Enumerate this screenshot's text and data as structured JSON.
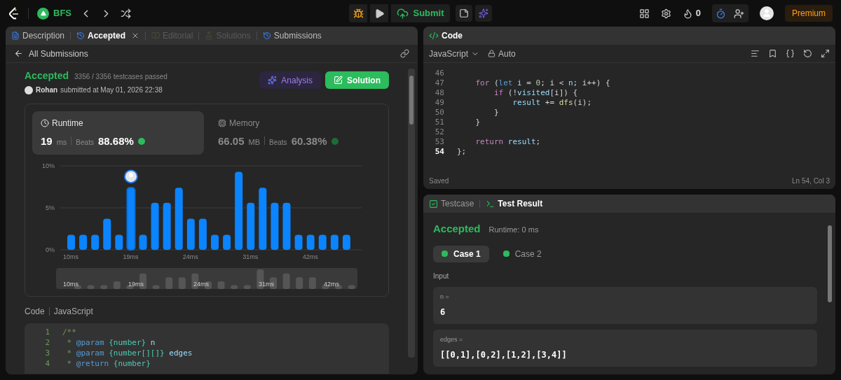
{
  "topbar": {
    "problem_title": "BFS",
    "submit_label": "Submit",
    "streak_count": "0",
    "premium_label": "Premium"
  },
  "left_panel": {
    "tabs": [
      {
        "label": "Description",
        "selected": false,
        "disabled": false,
        "kind": "description"
      },
      {
        "label": "Accepted",
        "selected": true,
        "disabled": false,
        "kind": "history"
      },
      {
        "label": "Editorial",
        "selected": false,
        "disabled": true,
        "kind": "editorial"
      },
      {
        "label": "Solutions",
        "selected": false,
        "disabled": true,
        "kind": "solutions"
      },
      {
        "label": "Submissions",
        "selected": false,
        "disabled": false,
        "kind": "history"
      }
    ],
    "back_label": "All Submissions",
    "status": "Accepted",
    "testcases": "3356 / 3356 testcases passed",
    "user": "Rohan",
    "submitted": "submitted at May 01, 2026 22:38",
    "analysis_label": "Analysis",
    "solution_label": "Solution",
    "stats": [
      {
        "title": "Runtime",
        "number": "19",
        "unit": "ms",
        "beats_label": "Beats",
        "beats": "88.68%",
        "selected": true,
        "kind": "runtime"
      },
      {
        "title": "Memory",
        "number": "66.05",
        "unit": "MB",
        "beats_label": "Beats",
        "beats": "60.38%",
        "selected": false,
        "kind": "memory"
      }
    ],
    "chart": {
      "chart_data": {
        "type": "bar",
        "categories": [
          "10ms",
          null,
          null,
          null,
          null,
          "19ms",
          null,
          null,
          null,
          null,
          "24ms",
          null,
          null,
          null,
          null,
          "31ms",
          null,
          null,
          null,
          null,
          "42ms",
          null,
          null,
          null
        ],
        "series": [
          {
            "color": "#0a84ff",
            "values": [
              1.8,
              1.8,
              1.8,
              3.7,
              1.8,
              7.4,
              1.8,
              5.6,
              5.6,
              7.4,
              3.7,
              3.7,
              1.8,
              1.8,
              9.3,
              5.6,
              7.4,
              5.6,
              5.6,
              1.8,
              1.8,
              1.8,
              1.8,
              1.8
            ]
          }
        ],
        "ylim": [
          0,
          10
        ],
        "yticks": [
          {
            "value": 0,
            "label": "0%"
          },
          {
            "value": 5,
            "label": "5%"
          },
          {
            "value": 10,
            "label": "10%"
          }
        ]
      },
      "bars": [
        {
          "selected": false
        },
        {
          "selected": false
        },
        {
          "selected": false
        },
        {
          "selected": false
        },
        {
          "selected": false
        },
        {
          "selected": true
        },
        {
          "selected": false
        },
        {
          "selected": false
        },
        {
          "selected": false
        },
        {
          "selected": false
        },
        {
          "selected": false
        },
        {
          "selected": false
        },
        {
          "selected": false
        },
        {
          "selected": false
        },
        {
          "selected": false
        },
        {
          "selected": false
        },
        {
          "selected": false
        },
        {
          "selected": false
        },
        {
          "selected": false
        },
        {
          "selected": false
        },
        {
          "selected": false
        },
        {
          "selected": false
        },
        {
          "selected": false
        },
        {
          "selected": false
        }
      ],
      "overview_labels": [
        "10ms",
        "19ms",
        "24ms",
        "31ms",
        "42ms"
      ]
    },
    "code_header": "Code",
    "code_language": "JavaScript",
    "code_lines": [
      {
        "n": "1",
        "tokens": [
          {
            "t": "/**",
            "kind": "comment"
          }
        ]
      },
      {
        "n": "2",
        "tokens": [
          {
            "t": " *",
            "kind": "comment"
          },
          {
            "t": " @param",
            "kind": "tag"
          },
          {
            "t": " {number}",
            "kind": "type"
          },
          {
            "t": " n",
            "kind": "var"
          }
        ]
      },
      {
        "n": "3",
        "tokens": [
          {
            "t": " *",
            "kind": "comment"
          },
          {
            "t": " @param",
            "kind": "tag"
          },
          {
            "t": " {number[][]}",
            "kind": "type"
          },
          {
            "t": " edges",
            "kind": "var"
          }
        ]
      },
      {
        "n": "4",
        "tokens": [
          {
            "t": " *",
            "kind": "comment"
          },
          {
            "t": " @return",
            "kind": "tag"
          },
          {
            "t": " {number}",
            "kind": "type"
          }
        ]
      }
    ]
  },
  "editor": {
    "title": "Code",
    "language": "JavaScript",
    "mode": "Auto",
    "status": "Saved",
    "cursor": "Ln 54, Col 3",
    "lines": [
      {
        "n": "46",
        "current": false
      },
      {
        "n": "47",
        "current": false,
        "tokens": [
          {
            "t": "    for",
            "kind": "kw"
          },
          {
            "t": " (",
            "kind": "plain"
          },
          {
            "t": "let",
            "kind": "decl"
          },
          {
            "t": " i ",
            "kind": "var"
          },
          {
            "t": "= ",
            "kind": "plain"
          },
          {
            "t": "0",
            "kind": "num"
          },
          {
            "t": "; i < ",
            "kind": "plain"
          },
          {
            "t": "n",
            "kind": "var"
          },
          {
            "t": "; i++) {",
            "kind": "plain"
          }
        ]
      },
      {
        "n": "48",
        "current": false,
        "tokens": [
          {
            "t": "        if",
            "kind": "kw"
          },
          {
            "t": " (!",
            "kind": "plain"
          },
          {
            "t": "visited",
            "kind": "var"
          },
          {
            "t": "[i]) {",
            "kind": "plain"
          }
        ]
      },
      {
        "n": "49",
        "current": false,
        "tokens": [
          {
            "t": "            result",
            "kind": "var"
          },
          {
            "t": " += ",
            "kind": "plain"
          },
          {
            "t": "dfs",
            "kind": "fn"
          },
          {
            "t": "(i);",
            "kind": "plain"
          }
        ]
      },
      {
        "n": "50",
        "current": false,
        "tokens": [
          {
            "t": "        }",
            "kind": "plain"
          }
        ]
      },
      {
        "n": "51",
        "current": false,
        "tokens": [
          {
            "t": "    }",
            "kind": "plain"
          }
        ]
      },
      {
        "n": "52",
        "current": false
      },
      {
        "n": "53",
        "current": false,
        "tokens": [
          {
            "t": "    return",
            "kind": "kw"
          },
          {
            "t": " result",
            "kind": "var"
          },
          {
            "t": ";",
            "kind": "plain"
          }
        ]
      },
      {
        "n": "54",
        "current": true,
        "tokens": [
          {
            "t": "};",
            "kind": "plain"
          }
        ]
      }
    ]
  },
  "result_panel": {
    "tabs": [
      {
        "label": "Testcase",
        "selected": false,
        "kind": "check"
      },
      {
        "label": "Test Result",
        "selected": true,
        "kind": "terminal"
      }
    ],
    "status": "Accepted",
    "runtime": "Runtime: 0 ms",
    "cases": [
      {
        "label": "Case 1",
        "selected": true
      },
      {
        "label": "Case 2",
        "selected": false
      }
    ],
    "input_label": "Input",
    "inputs": [
      {
        "name": "n =",
        "value": "6"
      },
      {
        "name": "edges =",
        "value": "[[0,1],[0,2],[1,2],[3,4]]"
      }
    ]
  }
}
